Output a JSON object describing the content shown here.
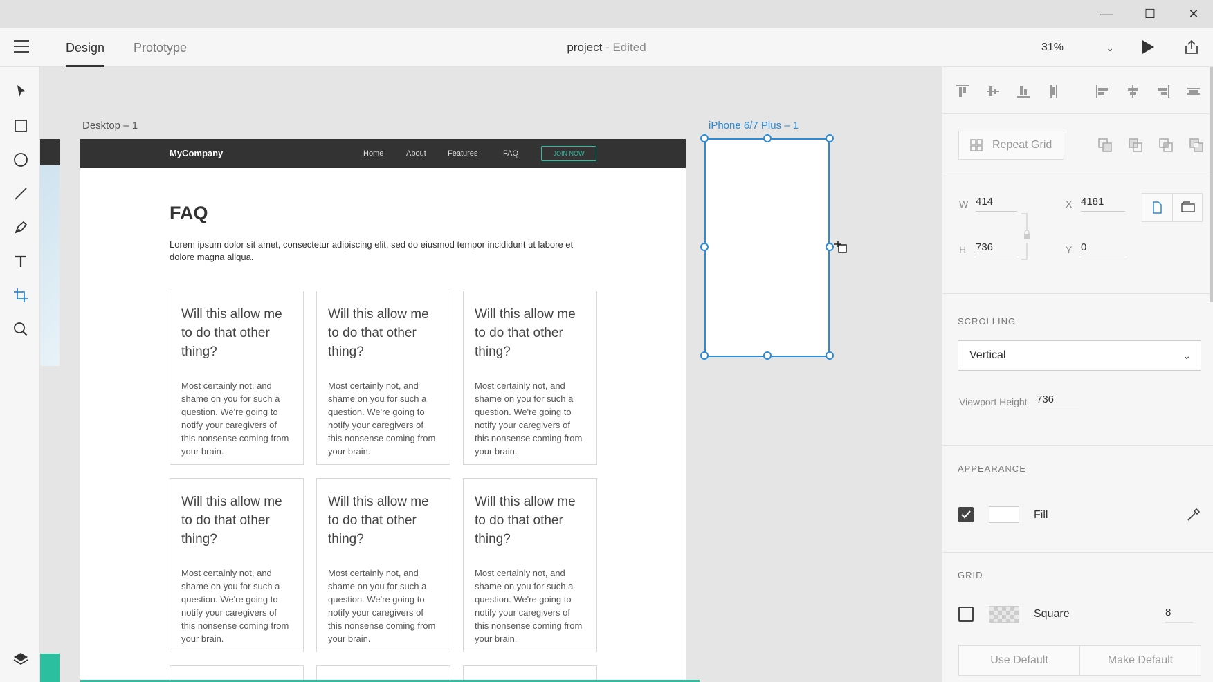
{
  "window": {
    "minimize": "—",
    "maximize": "☐",
    "close": "✕"
  },
  "toolbar": {
    "tabs": [
      {
        "label": "Design"
      },
      {
        "label": "Prototype"
      }
    ],
    "doc_name": "project",
    "doc_state": " - Edited",
    "zoom": "31%"
  },
  "canvas": {
    "desktop_label": "Desktop – 1",
    "iphone_label": "iPhone 6/7 Plus – 1",
    "site": {
      "brand": "MyCompany",
      "nav": [
        "Home",
        "About",
        "Features",
        "FAQ"
      ],
      "cta": "JOIN NOW",
      "heading": "FAQ",
      "intro": "Lorem ipsum dolor sit amet, consectetur adipiscing elit, sed do eiusmod tempor incididunt ut labore et dolore magna aliqua.",
      "cards": [
        {
          "q": "Will this allow me to do that other thing?",
          "a": "Most certainly not, and shame on you for such a question. We're going to notify your caregivers of this nonsense coming from your brain."
        },
        {
          "q": "Will this allow me to do that other thing?",
          "a": "Most certainly not, and shame on you for such a question. We're going to notify your caregivers of this nonsense coming from your brain."
        },
        {
          "q": "Will this allow me to do that other thing?",
          "a": "Most certainly not, and shame on you for such a question. We're going to notify your caregivers of this nonsense coming from your brain."
        },
        {
          "q": "Will this allow me to do that other thing?",
          "a": "Most certainly not, and shame on you for such a question. We're going to notify your caregivers of this nonsense coming from your brain."
        },
        {
          "q": "Will this allow me to do that other thing?",
          "a": "Most certainly not, and shame on you for such a question. We're going to notify your caregivers of this nonsense coming from your brain."
        },
        {
          "q": "Will this allow me to do that other thing?",
          "a": "Most certainly not, and shame on you for such a question. We're going to notify your caregivers of this nonsense coming from your brain."
        }
      ]
    }
  },
  "panel": {
    "repeat_grid": "Repeat Grid",
    "w_label": "W",
    "w": "414",
    "h_label": "H",
    "h": "736",
    "x_label": "X",
    "x": "4181",
    "y_label": "Y",
    "y": "0",
    "scrolling_title": "SCROLLING",
    "scrolling_value": "Vertical",
    "viewport_label": "Viewport Height",
    "viewport_value": "736",
    "appearance_title": "APPEARANCE",
    "fill_label": "Fill",
    "fill_checked": true,
    "grid_title": "GRID",
    "grid_type": "Square",
    "grid_size": "8",
    "use_default": "Use Default",
    "make_default": "Make Default"
  },
  "colors": {
    "selection": "#2d8ad5",
    "accent": "#2bbfa0",
    "nav_bg": "#333333"
  }
}
